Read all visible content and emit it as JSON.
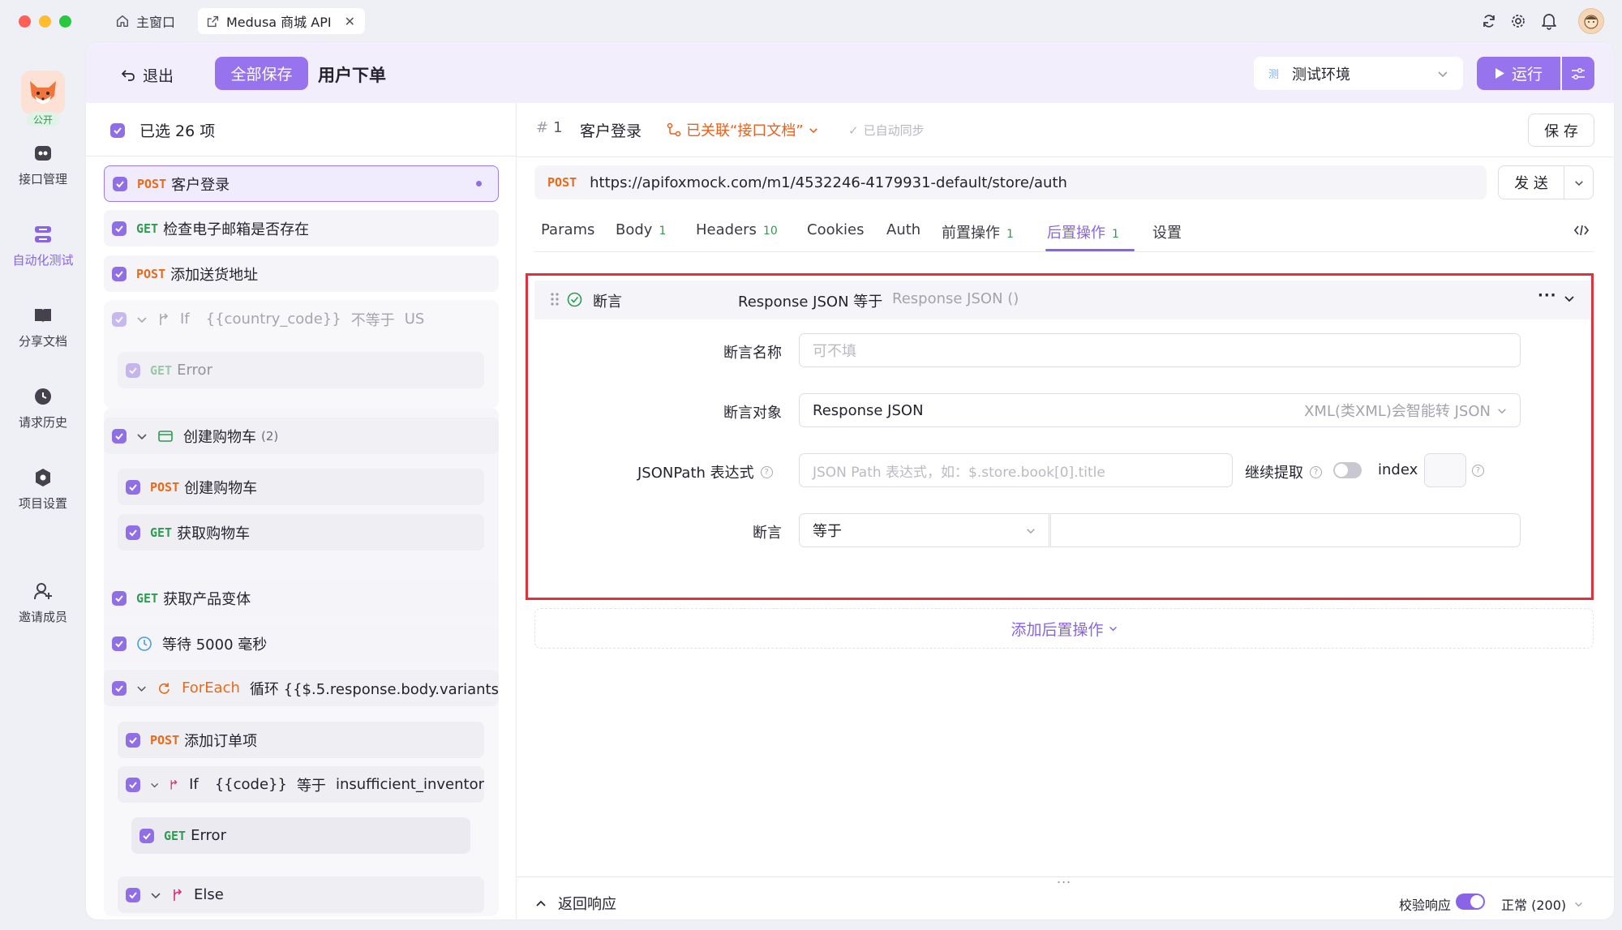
{
  "titlebar": {
    "home_tab": "主窗口",
    "project_tab": "Medusa 商城 API"
  },
  "sidebar": {
    "badge": "公开",
    "items": [
      {
        "label": "接口管理",
        "icon": "api-icon"
      },
      {
        "label": "自动化测试",
        "icon": "automation-icon",
        "active": true
      },
      {
        "label": "分享文档",
        "icon": "book-icon"
      },
      {
        "label": "请求历史",
        "icon": "clock-icon"
      },
      {
        "label": "项目设置",
        "icon": "settings-icon"
      },
      {
        "label": "邀请成员",
        "icon": "add-user-icon"
      }
    ]
  },
  "topbar": {
    "exit_label": "退出",
    "save_all_label": "全部保存",
    "scenario_title": "用户下单",
    "env_tag": "测",
    "env_name": "测试环境",
    "run_label": "运行"
  },
  "steps": {
    "selected_label": "已选 26 项",
    "items": [
      {
        "method": "POST",
        "name": "客户登录"
      },
      {
        "method": "GET",
        "name": "检查电子邮箱是否存在"
      },
      {
        "method": "POST",
        "name": "添加送货地址"
      },
      {
        "type": "If",
        "var": "{{country_code}}",
        "op": "不等于",
        "val": "US"
      },
      {
        "method": "GET",
        "name": "Error"
      },
      {
        "type": "group",
        "name": "创建购物车",
        "count": "(2)"
      },
      {
        "method": "POST",
        "name": "创建购物车"
      },
      {
        "method": "GET",
        "name": "获取购物车"
      },
      {
        "method": "GET",
        "name": "获取产品变体"
      },
      {
        "type": "wait",
        "name": "等待 5000 毫秒"
      },
      {
        "type": "ForEach",
        "name": "循环 {{$.5.response.body.variants"
      },
      {
        "method": "POST",
        "name": "添加订单项"
      },
      {
        "type": "If",
        "var": "{{code}}",
        "op": "等于",
        "val": "insufficient_inventor"
      },
      {
        "method": "GET",
        "name": "Error"
      },
      {
        "type": "Else",
        "name": "Else"
      }
    ]
  },
  "request": {
    "step_no": "1",
    "name": "客户登录",
    "linked_label": "已关联“接口文档”",
    "sync_label": "已自动同步",
    "save_label": "保 存",
    "method": "POST",
    "url": "https://apifoxmock.com/m1/4532246-4179931-default/store/auth",
    "send_label": "发 送",
    "tabs": [
      {
        "label": "Params",
        "count": ""
      },
      {
        "label": "Body",
        "count": "1"
      },
      {
        "label": "Headers",
        "count": "10"
      },
      {
        "label": "Cookies",
        "count": ""
      },
      {
        "label": "Auth",
        "count": ""
      },
      {
        "label": "前置操作",
        "count": "1"
      },
      {
        "label": "后置操作",
        "count": "1",
        "active": true
      },
      {
        "label": "设置",
        "count": ""
      }
    ]
  },
  "assertion": {
    "header_label": "断言",
    "summary": "Response JSON 等于",
    "summary_dim": "Response JSON ()",
    "name_label": "断言名称",
    "name_placeholder": "可不填",
    "target_label": "断言对象",
    "target_value": "Response JSON",
    "target_hint": "XML(类XML)会智能转 JSON",
    "jsonpath_label": "JSONPath 表达式",
    "jsonpath_placeholder": "JSON Path 表达式，如：$.store.book[0].title",
    "continue_label": "继续提取",
    "index_label": "index",
    "assert_label": "断言",
    "operator": "等于",
    "add_post_label": "添加后置操作"
  },
  "footer": {
    "back_label": "返回响应",
    "verify_label": "校验响应",
    "status_label": "正常 (200)",
    "more": "..."
  },
  "colors": {
    "accent": "#9773ee",
    "post": "#e86a1b",
    "get": "#2c9c4f",
    "highlight_border": "#e0323b"
  }
}
